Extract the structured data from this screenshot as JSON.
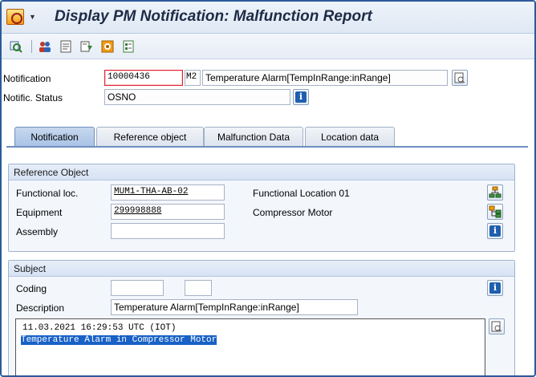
{
  "window": {
    "title": "Display PM Notification: Malfunction Report"
  },
  "toolbar": {
    "icons": [
      "display-object-icon",
      "partners-icon",
      "long-text-icon",
      "action-log-icon",
      "order-icon",
      "object-list-icon"
    ]
  },
  "header": {
    "notification_label": "Notification",
    "notification_value": "10000436",
    "notification_type": "M2",
    "notification_desc": "Temperature Alarm[TempInRange:inRange]",
    "status_label": "Notific. Status",
    "status_value": "OSNO"
  },
  "tabs": [
    {
      "label": "Notification",
      "active": true
    },
    {
      "label": "Reference object",
      "active": false
    },
    {
      "label": "Malfunction Data",
      "active": false
    },
    {
      "label": "Location data",
      "active": false
    }
  ],
  "reference_object": {
    "title": "Reference Object",
    "functional_loc_label": "Functional loc.",
    "functional_loc_value": "MUM1-THA-AB-02",
    "functional_loc_desc": "Functional Location 01",
    "equipment_label": "Equipment",
    "equipment_value": "299998888",
    "equipment_desc": "Compressor Motor",
    "assembly_label": "Assembly",
    "assembly_value": ""
  },
  "subject": {
    "title": "Subject",
    "coding_label": "Coding",
    "coding_group": "",
    "coding_code": "",
    "description_label": "Description",
    "description_value": "Temperature Alarm[TempInRange:inRange]",
    "long_text_line1": "11.03.2021 16:29:53 UTC (IOT)",
    "long_text_line2": "Temperature Alarm in Compressor Motor"
  },
  "colors": {
    "accent": "#1861c6",
    "title_text": "#1d2b46",
    "tab_active": "#a9c3e6"
  }
}
